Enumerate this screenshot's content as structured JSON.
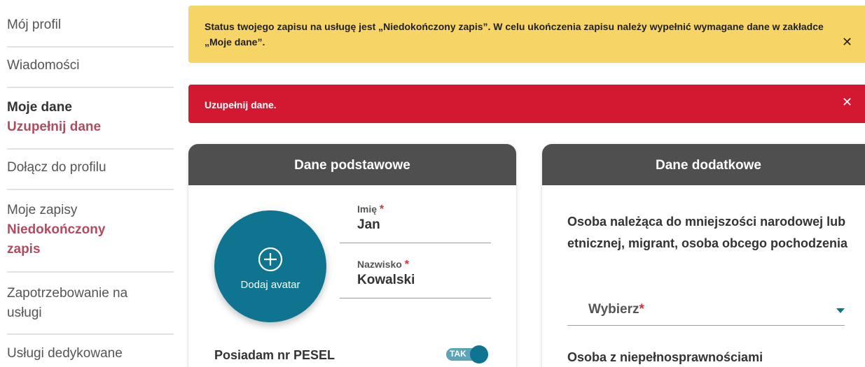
{
  "sidebar": {
    "items": [
      {
        "label": "Mój profil"
      },
      {
        "label": "Wiadomości"
      },
      {
        "label": "Moje dane",
        "sub": "Uzupełnij dane"
      },
      {
        "label": "Dołącz do profilu"
      },
      {
        "label": "Moje zapisy",
        "sub_line1": "Niedokończony",
        "sub_line2": "zapis"
      },
      {
        "label_line1": "Zapotrzebowanie na",
        "label_line2": "usługi"
      },
      {
        "label": "Usługi dedykowane"
      }
    ]
  },
  "alerts": {
    "warning": {
      "text": "Status twojego zapisu na usługę jest „Niedokończony zapis”. W celu ukończenia zapisu należy wypełnić wymagane dane w zakładce „Moje dane”.",
      "close": "✕",
      "color": "#f7d466"
    },
    "danger": {
      "text": "Uzupełnij dane.",
      "close": "✕",
      "color": "#d21931"
    }
  },
  "basic": {
    "title": "Dane podstawowe",
    "avatar_label": "Dodaj avatar",
    "first_name": {
      "label": "Imię",
      "required": "*",
      "value": "Jan"
    },
    "last_name": {
      "label": "Nazwisko",
      "required": "*",
      "value": "Kowalski"
    },
    "pesel_label": "Posiadam nr PESEL",
    "pesel_toggle": "TAK"
  },
  "extra": {
    "title": "Dane dodatkowe",
    "question1": "Osoba należąca do mniejszości narodowej lub etnicznej, migrant, osoba obcego pochodzenia",
    "select_placeholder": "Wybierz",
    "select_required": "*",
    "question2": "Osoba z niepełnosprawnościami"
  },
  "colors": {
    "accent": "#0e7490",
    "header": "#4f4f4f",
    "highlight": "#b04c5e"
  }
}
